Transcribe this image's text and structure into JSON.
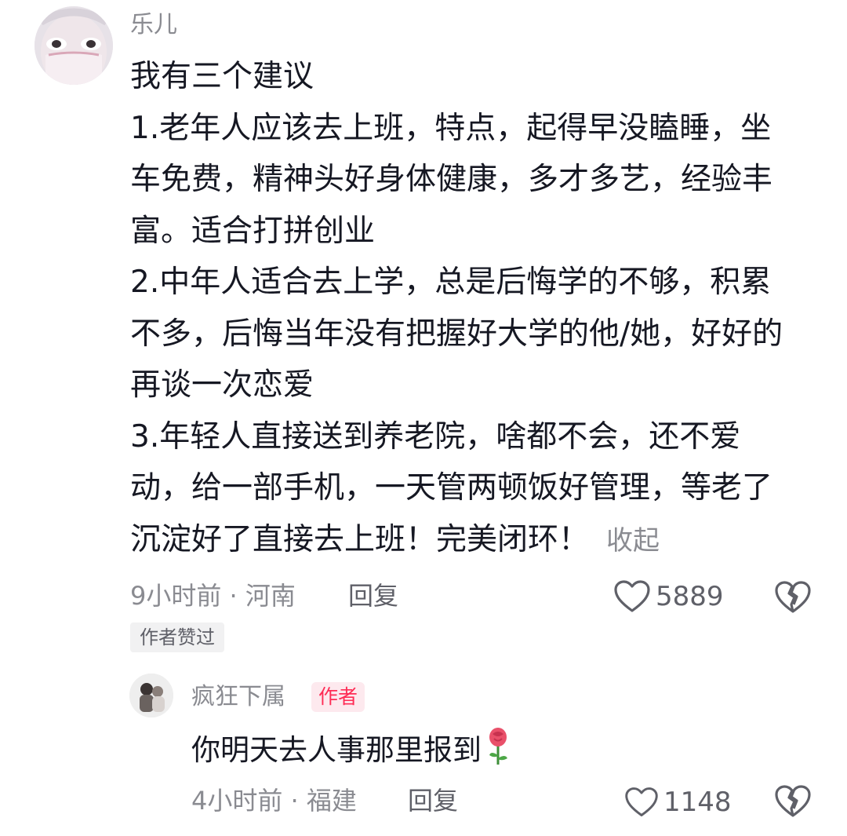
{
  "comment": {
    "username": "乐儿",
    "lines": [
      "我有三个建议",
      "1.老年人应该去上班，特点，起得早没瞌睡，坐",
      "车免费，精神头好身体健康，多才多艺，经验丰",
      "富。适合打拼创业",
      "2.中年人适合去上学，总是后悔学的不够，积累",
      "不多，后悔当年没有把握好大学的他/她，好好的",
      "再谈一次恋爱",
      "3.年轻人直接送到养老院，啥都不会，还不爱",
      "动，给一部手机，一天管两顿饭好管理，等老了",
      "沉淀好了直接去上班！完美闭环！"
    ],
    "collapse_label": "收起",
    "meta": "9小时前 · 河南",
    "reply_label": "回复",
    "like_count": "5889",
    "author_liked_badge": "作者赞过",
    "icons": [
      "avatar",
      "heart-icon",
      "broken-heart-icon"
    ]
  },
  "reply": {
    "username": "疯狂下属",
    "author_tag": "作者",
    "text": "你明天去人事那里报到",
    "meta": "4小时前 · 福建",
    "reply_label": "回复",
    "like_count": "1148",
    "icons": [
      "avatar",
      "rose-emoji",
      "heart-icon",
      "broken-heart-icon"
    ]
  },
  "colors": {
    "text_primary": "#161823",
    "text_secondary": "#8a8b91",
    "author_tag_text": "#fe2c55",
    "author_tag_bg": "#fde9ee",
    "badge_bg": "#f1f1f2"
  }
}
